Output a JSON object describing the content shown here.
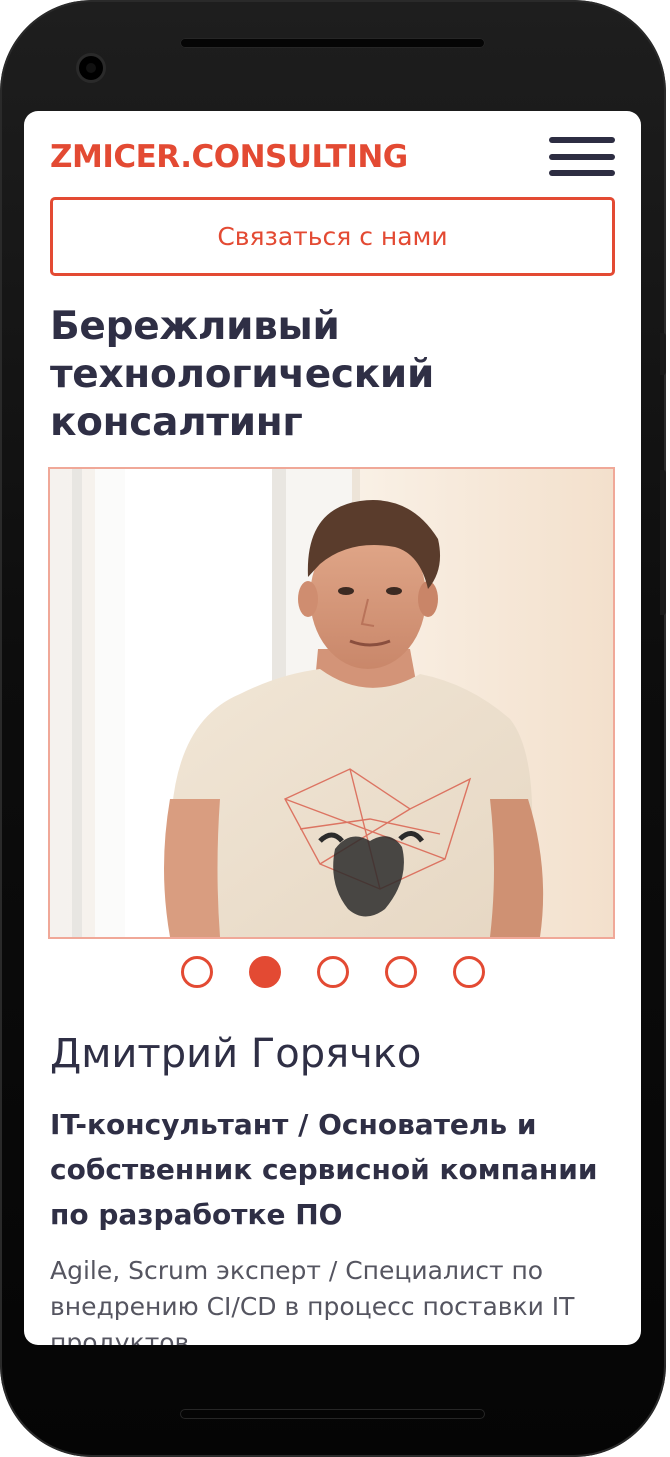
{
  "header": {
    "logo": "ZMICER.CONSULTING",
    "menu_icon": "hamburger-menu-icon"
  },
  "cta": {
    "label": "Связаться с нами"
  },
  "hero": {
    "headline": "Бережливый технологический консалтинг"
  },
  "carousel": {
    "slide_count": 5,
    "active_slide": 2
  },
  "profile": {
    "name": "Дмитрий Горячко",
    "role": "IT-консультант / Основатель и собственник сервисной компании по разработке ПО",
    "description": "Agile, Scrum эксперт / Специалист по внедрению CI/CD в процесс поставки IT продуктов"
  },
  "colors": {
    "accent": "#e34a33",
    "text_dark": "#2f2f45",
    "text_muted": "#555560"
  }
}
